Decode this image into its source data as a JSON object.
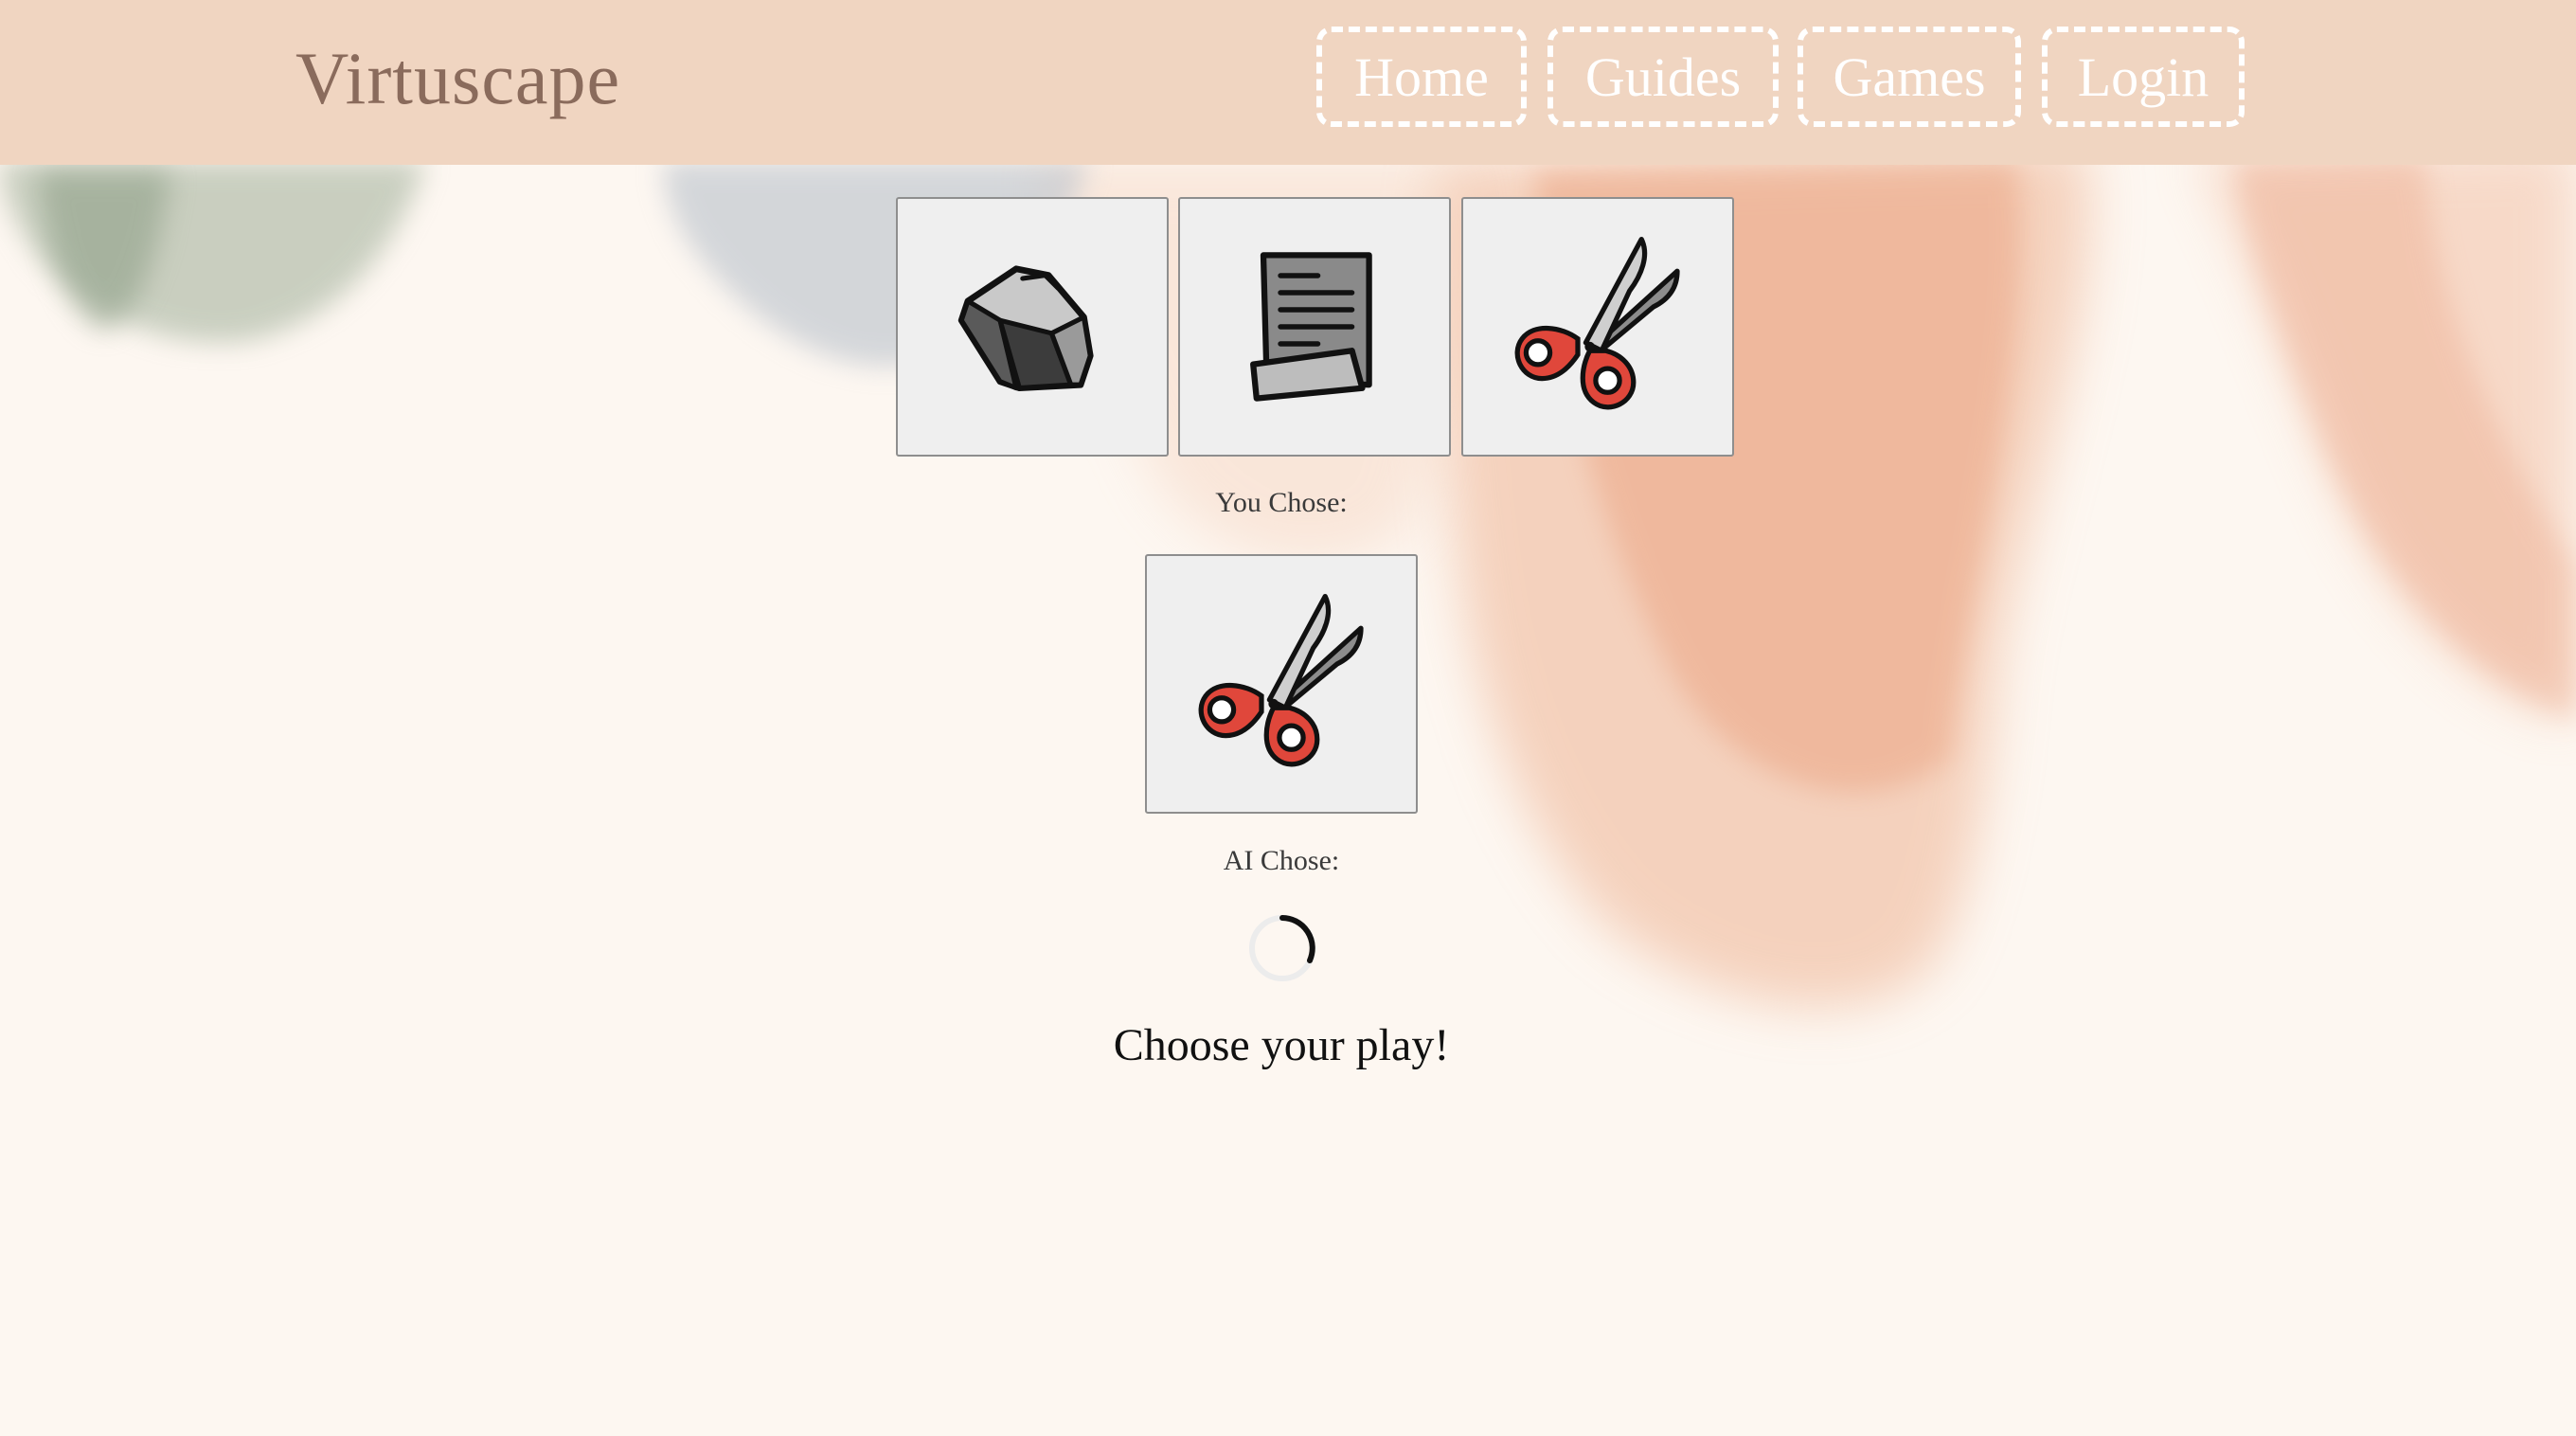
{
  "header": {
    "brand": "Virtuscape",
    "nav": [
      {
        "label": "Home"
      },
      {
        "label": "Guides"
      },
      {
        "label": "Games"
      },
      {
        "label": "Login"
      }
    ]
  },
  "game": {
    "choices": [
      {
        "icon": "rock-icon"
      },
      {
        "icon": "paper-icon"
      },
      {
        "icon": "scissors-icon"
      }
    ],
    "you_chose_label": "You Chose:",
    "you_chose_icon": "scissors-icon",
    "ai_chose_label": "AI Chose:",
    "ai_status_icon": "loading-spinner-icon",
    "prompt": "Choose your play!"
  },
  "colors": {
    "header_bg": "#f0d5c1",
    "page_bg": "#fdf7f1",
    "brand_text": "#8a6b5c",
    "scissors_handle": "#e0473b"
  }
}
